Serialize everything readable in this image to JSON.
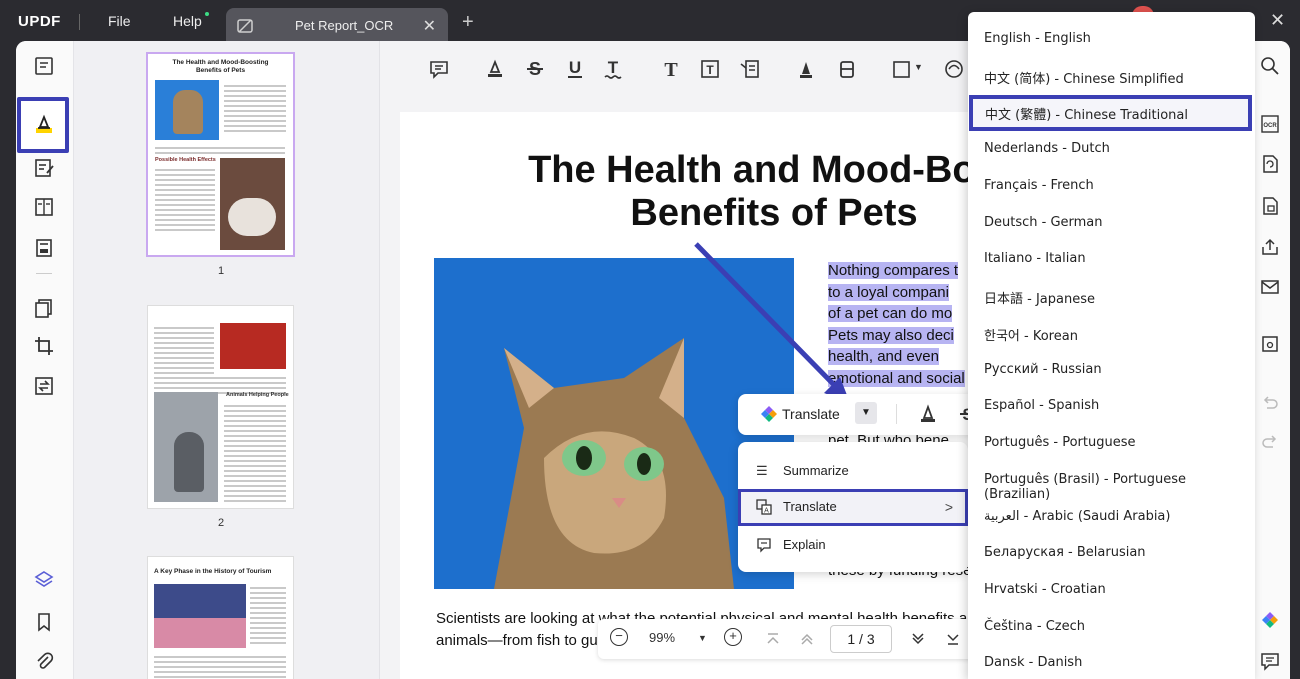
{
  "app": {
    "logo": "UPDF",
    "menu": [
      "File",
      "Help"
    ],
    "tab_title": "Pet Report_OCR",
    "tab_close": "✕",
    "tab_add": "+",
    "window_close": "✕"
  },
  "thumbnails": {
    "pages": [
      {
        "number": "1",
        "title": "The Health and Mood-Boosting Benefits of Pets",
        "subheading": "Possible Health Effects"
      },
      {
        "number": "2",
        "subheading": "Animals Helping People"
      },
      {
        "number": "",
        "title": "A Key Phase in the History of Tourism"
      }
    ]
  },
  "document": {
    "title_line1": "The Health and Mood-Boos",
    "title_line2": "Benefits of Pets",
    "paragraph_lines": [
      "Nothing compares t",
      "to a loyal compani",
      "of a pet can do mo",
      "Pets may also deci",
      "health, and even",
      "emotional and social"
    ],
    "partial_line": "pet. But who bene",
    "funding_line": "these by funding rese",
    "bottom_line1": "Scientists are looking at what the potential physical and mental health benefits are",
    "bottom_line2": "animals—from fish to gui"
  },
  "floating_toolbar": {
    "translate_label": "Translate",
    "dropdown_arrow": "▼"
  },
  "context_menu": {
    "items": [
      {
        "label": "Summarize",
        "icon": "list-icon"
      },
      {
        "label": "Translate",
        "icon": "translate-icon",
        "chevron": ">"
      },
      {
        "label": "Explain",
        "icon": "explain-icon"
      }
    ]
  },
  "bottom_bar": {
    "zoom": "99%",
    "zoom_minus": "−",
    "zoom_plus": "+",
    "page_indicator": "1 / 3"
  },
  "language_menu": {
    "selected": "中文 (繁體) - Chinese Traditional",
    "items": [
      "English - English",
      "中文 (简体) - Chinese Simplified",
      "中文 (繁體) - Chinese Traditional",
      "Nederlands - Dutch",
      "Français - French",
      "Deutsch - German",
      "Italiano - Italian",
      "日本語 - Japanese",
      "한국어 - Korean",
      "Русский - Russian",
      "Español - Spanish",
      "Português - Portuguese",
      "Português (Brasil) - Portuguese (Brazilian)",
      "العربية - Arabic (Saudi Arabia)",
      "Беларуская - Belarusian",
      "Hrvatski - Croatian",
      "Čeština - Czech",
      "Dansk - Danish"
    ]
  },
  "colors": {
    "accent": "#3b3fb4",
    "highlight": "#b7b4f2",
    "titlebar": "#2b2b30"
  }
}
